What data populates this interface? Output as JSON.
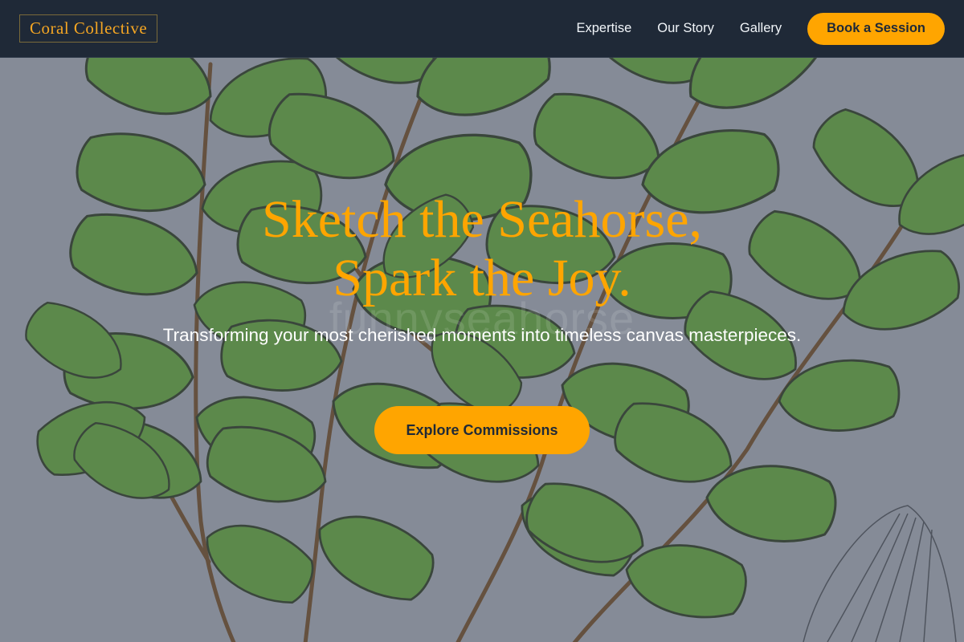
{
  "brand": {
    "name": "Coral Collective"
  },
  "nav": {
    "links": [
      "Expertise",
      "Our Story",
      "Gallery"
    ],
    "cta": "Book a Session"
  },
  "hero": {
    "title_line1": "Sketch the Seahorse,",
    "title_line2": "Spark the Joy.",
    "subtitle": "Transforming your most cherished moments into timeless canvas masterpieces.",
    "cta": "Explore Commissions",
    "watermark": "funnyseahorse",
    "background": "botanical fern leaf illustration"
  },
  "colors": {
    "header_bg": "#1f2937",
    "accent": "#ffa500",
    "leaf": "#5a9a3a",
    "stem": "#6b4a2a",
    "overlay": "#5a606e"
  }
}
